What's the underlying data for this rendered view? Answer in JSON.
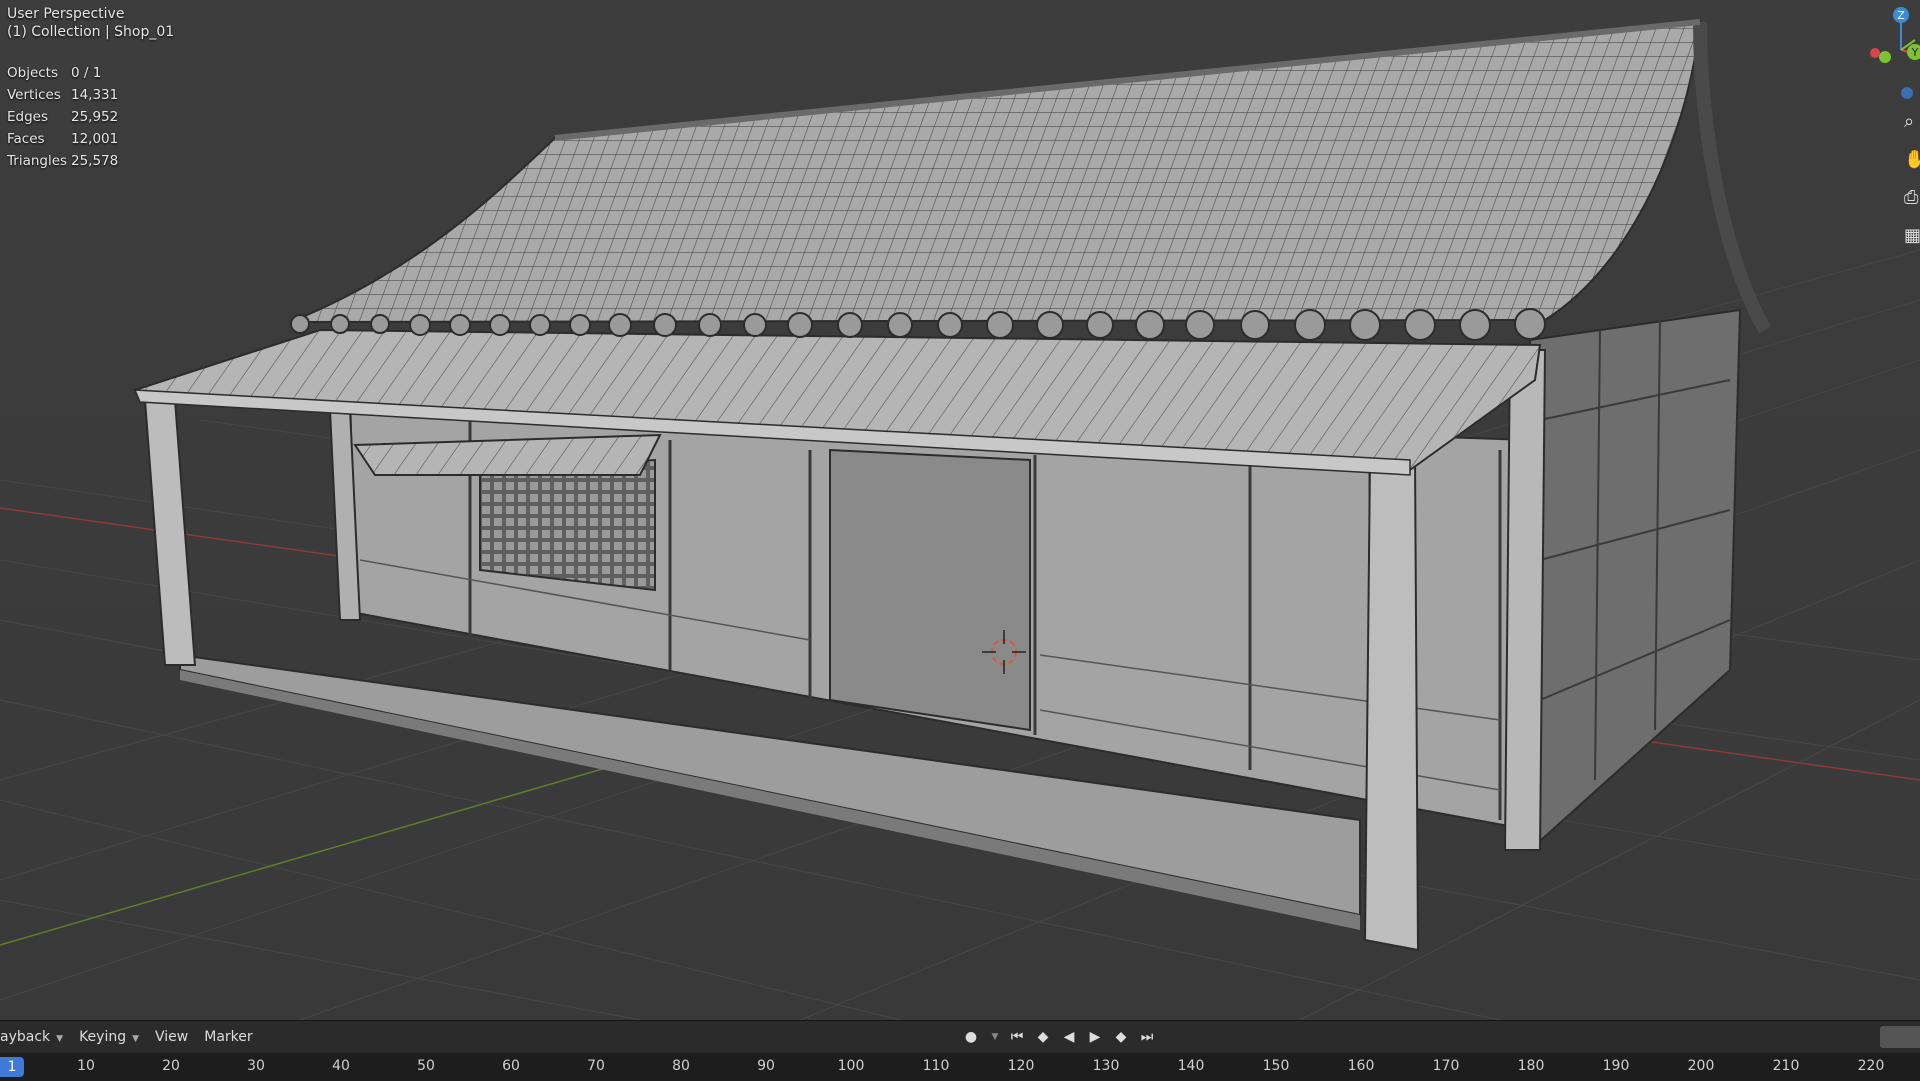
{
  "viewport": {
    "title": "User Perspective",
    "collection": "(1) Collection | Shop_01",
    "stats": [
      {
        "label": "Objects",
        "value": "0 / 1"
      },
      {
        "label": "Vertices",
        "value": "14,331"
      },
      {
        "label": "Edges",
        "value": "25,952"
      },
      {
        "label": "Faces",
        "value": "12,001"
      },
      {
        "label": "Triangles",
        "value": "25,578"
      }
    ],
    "gizmo": {
      "z_label": "Z",
      "y_label": "Y",
      "x_color": "#d9434c",
      "y_color": "#7ec233",
      "z_color": "#3c8bd8"
    },
    "side_icons": [
      "zoom-icon",
      "hand-pan-icon",
      "camera-icon",
      "grid-view-icon"
    ]
  },
  "timeline": {
    "menus": [
      {
        "label": "ayback",
        "dropdown": true
      },
      {
        "label": "Keying",
        "dropdown": true
      },
      {
        "label": "View",
        "dropdown": false
      },
      {
        "label": "Marker",
        "dropdown": false
      }
    ],
    "transport": {
      "record": "●",
      "jump_start": "⏮",
      "prev_key": "◆",
      "play_reverse": "◀",
      "play": "▶",
      "next_key": "◆",
      "jump_end": "⏭"
    },
    "current_frame": "1",
    "ruler_ticks": [
      "10",
      "20",
      "30",
      "40",
      "50",
      "60",
      "70",
      "80",
      "90",
      "100",
      "110",
      "120",
      "130",
      "140",
      "150",
      "160",
      "170",
      "180",
      "190",
      "200",
      "210",
      "220"
    ]
  }
}
